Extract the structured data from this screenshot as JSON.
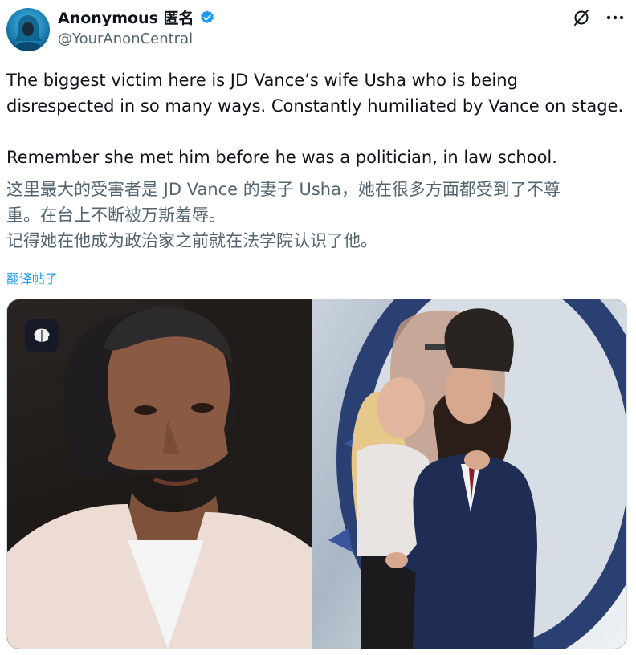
{
  "author": {
    "display_name": "Anonymous 匿名",
    "handle": "@YourAnonCentral",
    "verified": true
  },
  "actions": {
    "grok_icon": "grok-slash-icon",
    "more_icon": "more-dots-icon"
  },
  "tweet": {
    "line1": "The biggest victim here is JD Vance’s wife Usha who is being",
    "line2": "disrespected in so many ways. Constantly humiliated by Vance on stage.",
    "line3": "Remember she met him before he was a politician, in law school."
  },
  "translation": {
    "line1": "这里最大的受害者是 JD Vance 的妻子 Usha，她在很多方面都受到了不尊",
    "line2": "重。在台上不断被万斯羞辱。",
    "line3": "记得她在他成为政治家之前就在法学院认识了他。"
  },
  "translate_label": "翻译帖子",
  "colors": {
    "text": "#0f1419",
    "secondary": "#536471",
    "link": "#1d9bf0",
    "verified": "#1d9bf0"
  }
}
